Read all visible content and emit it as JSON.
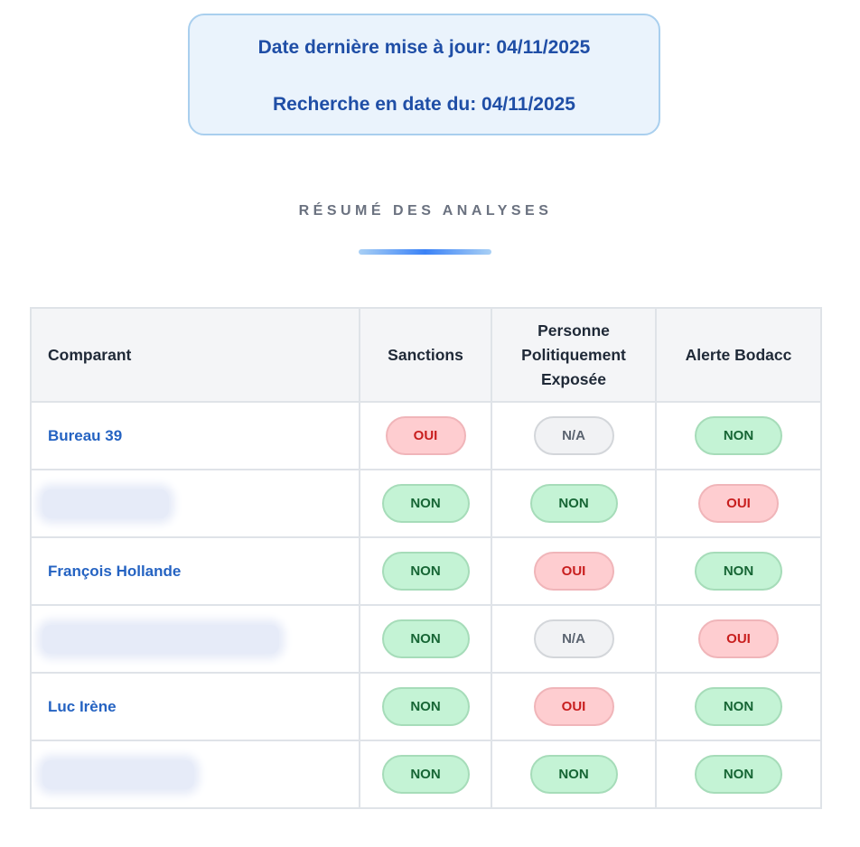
{
  "header": {
    "last_update": "Date dernière mise à jour: 04/11/2025",
    "search_date": "Recherche en date du: 04/11/2025"
  },
  "section": {
    "title": "RÉSUMÉ DES ANALYSES"
  },
  "table": {
    "headers": [
      "Comparant",
      "Sanctions",
      "Personne Politiquement Exposée",
      "Alerte Bodacc"
    ],
    "rows": [
      {
        "name": "Bureau 39",
        "redacted": false,
        "sanctions": "OUI",
        "pep": "N/A",
        "bodacc": "NON"
      },
      {
        "name": "",
        "redacted": true,
        "sanctions": "NON",
        "pep": "NON",
        "bodacc": "OUI"
      },
      {
        "name": "François Hollande",
        "redacted": false,
        "sanctions": "NON",
        "pep": "OUI",
        "bodacc": "NON"
      },
      {
        "name": "",
        "redacted": true,
        "sanctions": "NON",
        "pep": "N/A",
        "bodacc": "OUI"
      },
      {
        "name": "Luc Irène",
        "redacted": false,
        "sanctions": "NON",
        "pep": "OUI",
        "bodacc": "NON"
      },
      {
        "name": "",
        "redacted": true,
        "sanctions": "NON",
        "pep": "NON",
        "bodacc": "NON"
      }
    ]
  },
  "colors": {
    "accent": "#2563c2",
    "oui": "#c81e1e",
    "non": "#166534",
    "na": "#5b6470"
  }
}
